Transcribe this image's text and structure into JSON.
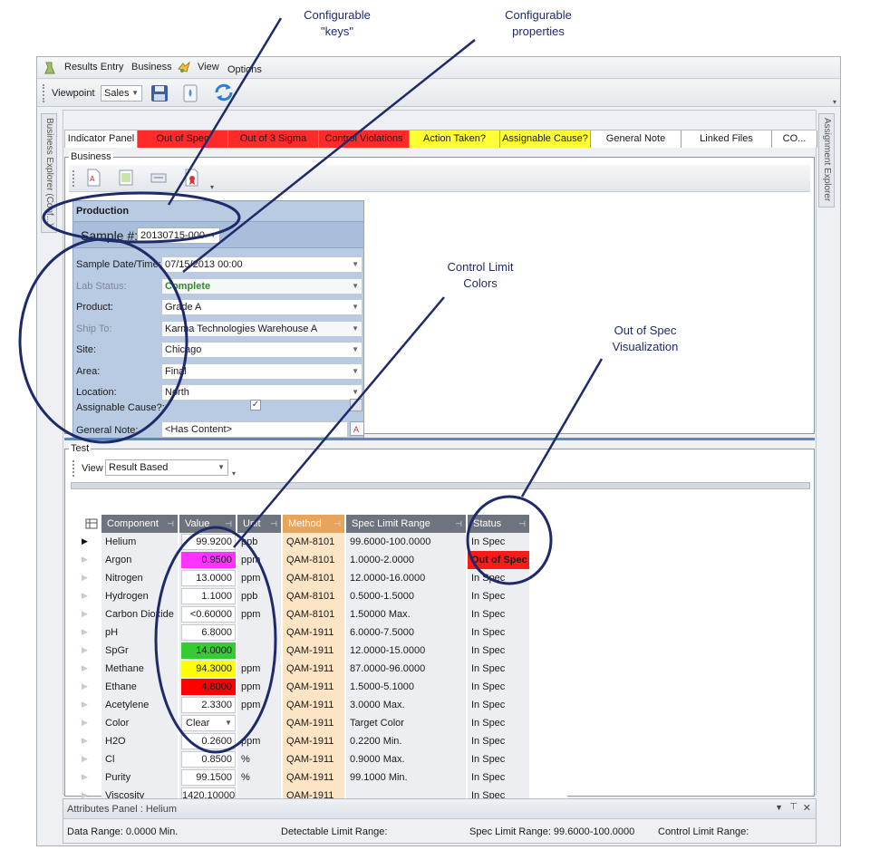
{
  "callouts": {
    "keys": [
      "Configurable",
      "\"keys\""
    ],
    "props": [
      "Configurable",
      "properties"
    ],
    "control": [
      "Control Limit",
      "Colors"
    ],
    "oos": [
      "Out of Spec",
      "Visualization"
    ]
  },
  "menu": {
    "results_entry": "Results Entry",
    "business": "Business",
    "view": "View",
    "options": "Options"
  },
  "toolbar": {
    "viewpoint_label": "Viewpoint",
    "viewpoint_value": "Sales"
  },
  "side": {
    "left": "Business Explorer (Conf...)",
    "right": "Assignment Explorer"
  },
  "indicator": {
    "label": "Indicator Panel",
    "cells": [
      {
        "text": "Out of Spec",
        "bg": "#ff2a2a"
      },
      {
        "text": "Out of 3 Sigma",
        "bg": "#ff2a2a"
      },
      {
        "text": "Control Violations",
        "bg": "#ff2a2a"
      },
      {
        "text": "Action Taken?",
        "bg": "#ffff33"
      },
      {
        "text": "Assignable Cause?",
        "bg": "#ffff33"
      },
      {
        "text": "General Note",
        "bg": "#ffffff"
      },
      {
        "text": "Linked Files",
        "bg": "#ffffff"
      },
      {
        "text": "CO...",
        "bg": "#ffffff"
      }
    ]
  },
  "business": {
    "label": "Business",
    "section": "Production",
    "sample_label": "Sample #:",
    "sample_value": "20130715-000",
    "fields": [
      {
        "label": "Sample Date/Time:",
        "value": "07/15/2013 00:00",
        "dim": false,
        "arrow": true
      },
      {
        "label": "Lab Status:",
        "value": "Complete",
        "dim": true,
        "arrow": true,
        "green": true
      },
      {
        "label": "Product:",
        "value": "Grade A",
        "dim": false,
        "arrow": true
      },
      {
        "label": "Ship To:",
        "value": "Karma Technologies Warehouse A",
        "dim": true,
        "arrow": true
      },
      {
        "label": "Site:",
        "value": "Chicago",
        "dim": false,
        "arrow": true
      },
      {
        "label": "Area:",
        "value": "Final",
        "dim": false,
        "arrow": true
      },
      {
        "label": "Location:",
        "value": "North",
        "dim": false,
        "arrow": true
      }
    ],
    "assignable_label": "Assignable Cause?:",
    "note_label": "General Note:",
    "note_value": "<Has Content>"
  },
  "test": {
    "label": "Test",
    "view_label": "View",
    "view_value": "Result Based",
    "columns": [
      "Component",
      "Value",
      "Unit",
      "Method",
      "Spec Limit Range",
      "Status"
    ],
    "rows": [
      {
        "component": "Helium",
        "value": "99.9200",
        "unit": "ppb",
        "method": "QAM-8101",
        "range": "99.6000-100.0000",
        "status": "In Spec",
        "vbg": "#ffffff",
        "sbg": "",
        "current": true
      },
      {
        "component": "Argon",
        "value": "0.9500",
        "unit": "ppm",
        "method": "QAM-8101",
        "range": "1.0000-2.0000",
        "status": "Out of Spec",
        "vbg": "#ff33ff",
        "sbg": "#ff1a1a"
      },
      {
        "component": "Nitrogen",
        "value": "13.0000",
        "unit": "ppm",
        "method": "QAM-8101",
        "range": "12.0000-16.0000",
        "status": "In Spec",
        "vbg": "#ffffff",
        "sbg": ""
      },
      {
        "component": "Hydrogen",
        "value": "1.1000",
        "unit": "ppb",
        "method": "QAM-8101",
        "range": "0.5000-1.5000",
        "status": "In Spec",
        "vbg": "#ffffff",
        "sbg": ""
      },
      {
        "component": "Carbon Dioxide",
        "value": "<0.60000",
        "unit": "ppm",
        "method": "QAM-8101",
        "range": "1.50000 Max.",
        "status": "In Spec",
        "vbg": "#ffffff",
        "sbg": ""
      },
      {
        "component": "pH",
        "value": "6.8000",
        "unit": "",
        "method": "QAM-1911",
        "range": "6.0000-7.5000",
        "status": "In Spec",
        "vbg": "#ffffff",
        "sbg": ""
      },
      {
        "component": "SpGr",
        "value": "14.0000",
        "unit": "",
        "method": "QAM-1911",
        "range": "12.0000-15.0000",
        "status": "In Spec",
        "vbg": "#33cc33",
        "sbg": ""
      },
      {
        "component": "Methane",
        "value": "94.3000",
        "unit": "ppm",
        "method": "QAM-1911",
        "range": "87.0000-96.0000",
        "status": "In Spec",
        "vbg": "#ffff00",
        "sbg": ""
      },
      {
        "component": "Ethane",
        "value": "4.8000",
        "unit": "ppm",
        "method": "QAM-1911",
        "range": "1.5000-5.1000",
        "status": "In Spec",
        "vbg": "#ff0000",
        "sbg": ""
      },
      {
        "component": "Acetylene",
        "value": "2.3300",
        "unit": "ppm",
        "method": "QAM-1911",
        "range": "3.0000 Max.",
        "status": "In Spec",
        "vbg": "#ffffff",
        "sbg": ""
      },
      {
        "component": "Color",
        "value": "Clear",
        "unit": "",
        "method": "QAM-1911",
        "range": "Target Color",
        "status": "In Spec",
        "vbg": "#ffffff",
        "sbg": "",
        "combo": true
      },
      {
        "component": "H2O",
        "value": "0.2600",
        "unit": "ppm",
        "method": "QAM-1911",
        "range": "0.2200 Min.",
        "status": "In Spec",
        "vbg": "#ffffff",
        "sbg": ""
      },
      {
        "component": "Cl",
        "value": "0.8500",
        "unit": "%",
        "method": "QAM-1911",
        "range": "0.9000 Max.",
        "status": "In Spec",
        "vbg": "#ffffff",
        "sbg": ""
      },
      {
        "component": "Purity",
        "value": "99.1500",
        "unit": "%",
        "method": "QAM-1911",
        "range": "99.1000 Min.",
        "status": "In Spec",
        "vbg": "#ffffff",
        "sbg": ""
      },
      {
        "component": "Viscosity",
        "value": "1420.10000",
        "unit": "",
        "method": "QAM-1911",
        "range": "",
        "status": "In Spec",
        "vbg": "#ffffff",
        "sbg": ""
      }
    ]
  },
  "attributes": {
    "title": "Attributes Panel : Helium",
    "data_range": "Data Range:  0.0000 Min.",
    "detectable": "Detectable Limit Range:",
    "spec": "Spec Limit Range:  99.6000-100.0000",
    "control": "Control Limit Range:"
  },
  "colors": {
    "annotation": "#1f2a6b",
    "method_header": "#e8a45a",
    "method_col": "#fce4c4"
  }
}
